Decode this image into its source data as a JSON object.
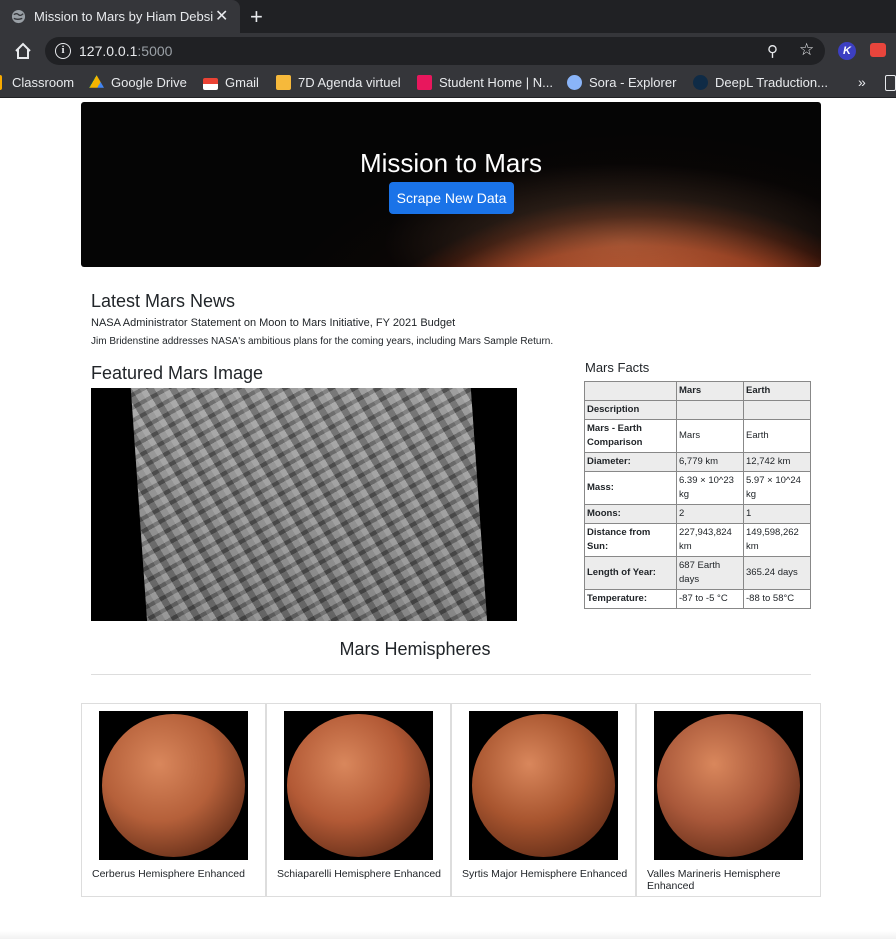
{
  "browser": {
    "tab_title": "Mission to Mars by Hiam Debsi",
    "new_tab": "+",
    "close": "✕",
    "url_host": "127.0.0.1",
    "url_port": ":5000",
    "bookmarks": [
      "Classroom",
      "Google Drive",
      "Gmail",
      "7D Agenda virtuel",
      "Student Home | N...",
      "Sora - Explorer",
      "DeepL Traduction..."
    ],
    "more": "»",
    "ext_k": "K"
  },
  "jumbotron": {
    "title": "Mission to Mars",
    "button": "Scrape New Data"
  },
  "news": {
    "heading": "Latest Mars News",
    "title": "NASA Administrator Statement on Moon to Mars Initiative, FY 2021 Budget",
    "paragraph": "Jim Bridenstine addresses NASA's ambitious plans for the coming years, including Mars Sample Return."
  },
  "featured": {
    "heading": "Featured Mars Image"
  },
  "facts": {
    "heading": "Mars Facts",
    "columns": [
      "",
      "Mars",
      "Earth"
    ],
    "rows": [
      [
        "Description",
        "",
        ""
      ],
      [
        "Mars - Earth Comparison",
        "Mars",
        "Earth"
      ],
      [
        "Diameter:",
        "6,779 km",
        "12,742 km"
      ],
      [
        "Mass:",
        "6.39 × 10^23 kg",
        "5.97 × 10^24 kg"
      ],
      [
        "Moons:",
        "2",
        "1"
      ],
      [
        "Distance from Sun:",
        "227,943,824 km",
        "149,598,262 km"
      ],
      [
        "Length of Year:",
        "687 Earth days",
        "365.24 days"
      ],
      [
        "Temperature:",
        "-87 to -5 °C",
        "-88 to 58°C"
      ]
    ]
  },
  "hemispheres": {
    "heading": "Mars Hemispheres",
    "items": [
      {
        "title": "Cerberus Hemisphere Enhanced",
        "color": "#b5603a"
      },
      {
        "title": "Schiaparelli Hemisphere Enhanced",
        "color": "#b35a36"
      },
      {
        "title": "Syrtis Major Hemisphere Enhanced",
        "color": "#a8552f"
      },
      {
        "title": "Valles Marineris Hemisphere Enhanced",
        "color": "#a9583a"
      }
    ]
  }
}
